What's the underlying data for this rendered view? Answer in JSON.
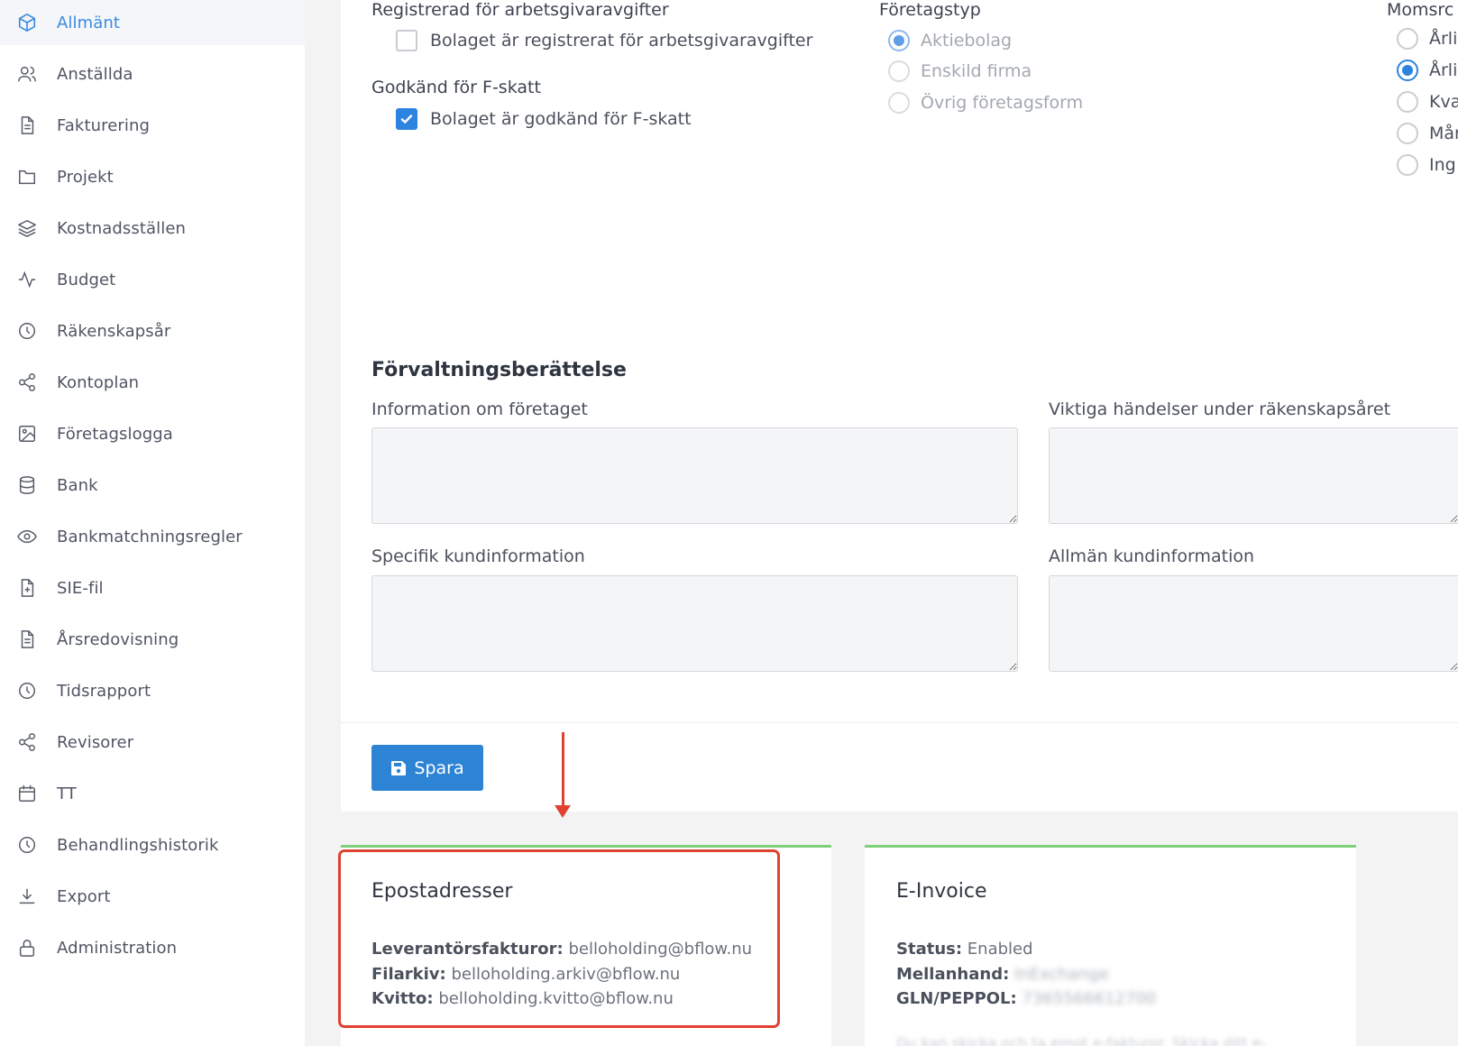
{
  "sidebar": {
    "items": [
      {
        "label": "Allmänt",
        "icon": "cube-icon",
        "active": true
      },
      {
        "label": "Anställda",
        "icon": "users-icon"
      },
      {
        "label": "Fakturering",
        "icon": "document-icon"
      },
      {
        "label": "Projekt",
        "icon": "folder-icon"
      },
      {
        "label": "Kostnadsställen",
        "icon": "layers-icon"
      },
      {
        "label": "Budget",
        "icon": "activity-icon"
      },
      {
        "label": "Räkenskapsår",
        "icon": "clock-icon"
      },
      {
        "label": "Kontoplan",
        "icon": "share-icon"
      },
      {
        "label": "Företagslogga",
        "icon": "image-icon"
      },
      {
        "label": "Bank",
        "icon": "database-icon"
      },
      {
        "label": "Bankmatchningsregler",
        "icon": "eye-icon"
      },
      {
        "label": "SIE-fil",
        "icon": "file-plus-icon"
      },
      {
        "label": "Årsredovisning",
        "icon": "document-icon"
      },
      {
        "label": "Tidsrapport",
        "icon": "clock-icon"
      },
      {
        "label": "Revisorer",
        "icon": "share-icon"
      },
      {
        "label": "TT",
        "icon": "calendar-icon"
      },
      {
        "label": "Behandlingshistorik",
        "icon": "clock-icon"
      },
      {
        "label": "Export",
        "icon": "download-icon"
      },
      {
        "label": "Administration",
        "icon": "lock-icon"
      }
    ]
  },
  "employer": {
    "label": "Registrerad för arbetsgivaravgifter",
    "checkbox_label": "Bolaget är registrerat för arbetsgivaravgifter",
    "checked": false
  },
  "ftax": {
    "label": "Godkänd för F-skatt",
    "checkbox_label": "Bolaget är godkänd för F-skatt",
    "checked": true
  },
  "company_type": {
    "label": "Företagstyp",
    "options": [
      {
        "label": "Aktiebolag",
        "checked": true
      },
      {
        "label": "Enskild firma",
        "checked": false
      },
      {
        "label": "Övrig företagsform",
        "checked": false
      }
    ]
  },
  "vat": {
    "label": "Momsrc",
    "options": [
      {
        "label": "Årlig",
        "checked": false
      },
      {
        "label": "Årlig",
        "checked": true
      },
      {
        "label": "Kva",
        "checked": false
      },
      {
        "label": "Mån",
        "checked": false
      },
      {
        "label": "Ing",
        "checked": false
      }
    ]
  },
  "management_report": {
    "heading": "Förvaltningsberättelse",
    "fields": {
      "info": "Information om företaget",
      "events": "Viktiga händelser under räkenskapsåret",
      "specific": "Specifik kundinformation",
      "general": "Allmän kundinformation"
    }
  },
  "save_label": "Spara",
  "email_card": {
    "title": "Epostadresser",
    "lines": [
      {
        "key": "Leverantörsfakturor:",
        "value": "belloholding@bflow.nu"
      },
      {
        "key": "Filarkiv:",
        "value": "belloholding.arkiv@bflow.nu"
      },
      {
        "key": "Kvitto:",
        "value": "belloholding.kvitto@bflow.nu"
      }
    ]
  },
  "einvoice_card": {
    "title": "E-Invoice",
    "status_key": "Status:",
    "status_value": "Enabled",
    "intermediary_key": "Mellanhand:",
    "intermediary_value": "InExchange",
    "gln_key": "GLN/PEPPOL:",
    "gln_value": "7365566612700",
    "footer": "Du kan skicka och ta emot e-fakturor. Skicka ditt e-"
  },
  "colors": {
    "accent": "#2d83e0",
    "highlight": "#e04232",
    "card_top": "#7ed07a"
  }
}
